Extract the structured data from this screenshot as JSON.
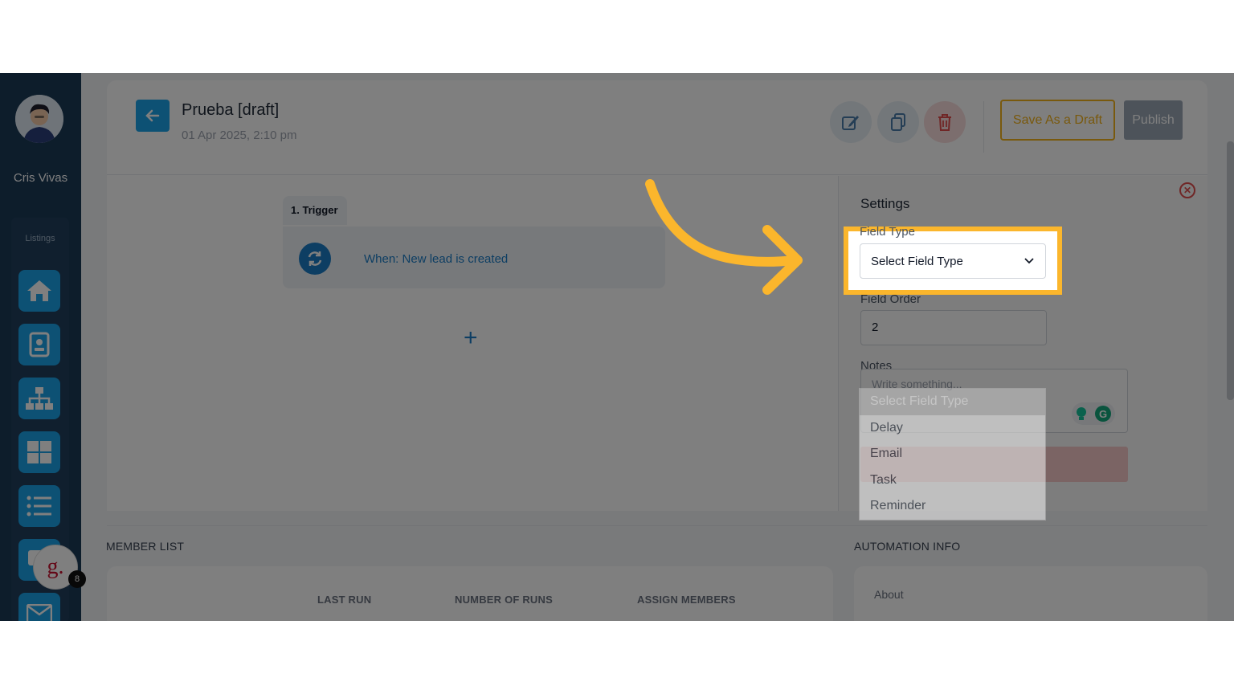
{
  "sidebar": {
    "user_name": "Cris Vivas",
    "section_label": "Listings",
    "nav_icons": [
      "home-icon",
      "contact-card-icon",
      "sitemap-icon",
      "grid-icon",
      "list-icon",
      "chat-icon",
      "mail-icon"
    ],
    "chat_badge": "g.",
    "chat_count": "8"
  },
  "header": {
    "title": "Prueba [draft]",
    "date": "01 Apr 2025, 2:10 pm",
    "save_draft_label": "Save As a Draft",
    "publish_label": "Publish"
  },
  "workflow": {
    "trigger_tab": "1.  Trigger",
    "trigger_text": "When: New lead is created",
    "add_label": "+"
  },
  "settings": {
    "title": "Settings",
    "field_type_label": "Field Type",
    "field_type_value": "Select Field Type",
    "field_order_label": "Field Order",
    "field_order_value": "2",
    "notes_label": "Notes",
    "notes_placeholder": "Write something..."
  },
  "dropdown": {
    "options": [
      "Select Field Type",
      "Delay",
      "Email",
      "Task",
      "Reminder"
    ],
    "selected_index": 0
  },
  "member_list": {
    "title": "MEMBER LIST",
    "columns": [
      "LAST RUN",
      "NUMBER OF RUNS",
      "ASSIGN MEMBERS"
    ]
  },
  "automation_info": {
    "title": "AUTOMATION INFO",
    "about_label": "About"
  },
  "colors": {
    "accent": "#1aa3e8",
    "highlight": "#fbb62c",
    "draft": "#f3b21b",
    "sidebar": "#1b3a57"
  }
}
